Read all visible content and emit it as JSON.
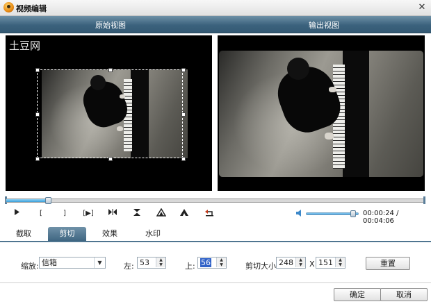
{
  "window": {
    "title": "视频编辑",
    "close_symbol": "✕"
  },
  "view_header": {
    "original": "原始视图",
    "output": "输出视图"
  },
  "preview": {
    "watermark_text": "土豆网"
  },
  "timeline": {
    "position_fraction": 0.1
  },
  "controls": {
    "play_icon": "play-icon",
    "mark_in_label": "[",
    "mark_out_label": "]",
    "clip_range_label": "[▶]",
    "icons": [
      "play-icon",
      "mark-in-icon",
      "mark-out-icon",
      "play-range-icon",
      "split-icon",
      "split-center-icon",
      "fade-in-icon",
      "fade-out-icon",
      "undo-icon"
    ]
  },
  "volume": {
    "level_fraction": 0.9
  },
  "time": {
    "current": "00:00:24",
    "separator": "/",
    "total": "00:04:06"
  },
  "tabs": [
    {
      "label": "截取"
    },
    {
      "label": "剪切"
    },
    {
      "label": "效果"
    },
    {
      "label": "水印"
    }
  ],
  "active_tab": "剪切",
  "crop_form": {
    "zoom_label": "缩放:",
    "zoom_value": "信箱",
    "left_label": "左:",
    "left_value": "53",
    "top_label": "上:",
    "top_value": "56",
    "size_label": "剪切大小:",
    "width_value": "248",
    "x_separator": "X",
    "height_value": "151",
    "reset_label": "重置"
  },
  "footer": {
    "ok_label": "确定",
    "cancel_label": "取消"
  },
  "colors": {
    "header_bar": "#3b627d",
    "accent_blue": "#3b9ed8",
    "preview_bg": "#000000"
  }
}
